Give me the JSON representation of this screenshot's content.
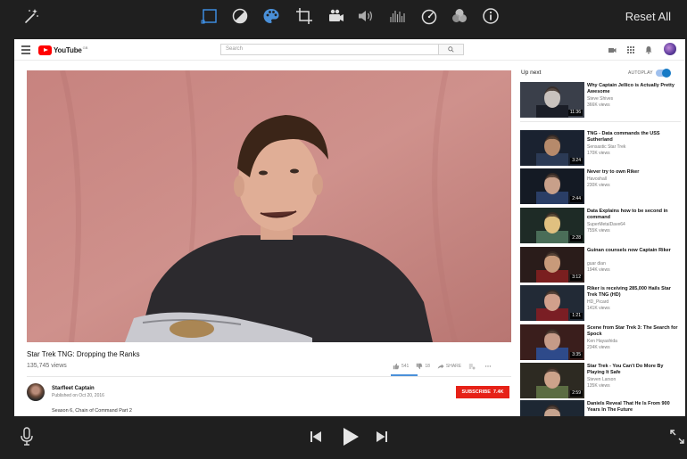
{
  "toolbar": {
    "reset_label": "Reset All",
    "icons": [
      "magic-wand-icon",
      "crop-frame-icon",
      "color-balance-icon",
      "color-palette-icon",
      "crop-icon",
      "video-camera-icon",
      "volume-icon",
      "equalizer-icon",
      "speedometer-icon",
      "filters-icon",
      "info-icon"
    ]
  },
  "youtube": {
    "logo_text": "YouTube",
    "region": "GB",
    "search_placeholder": "Search",
    "video_title": "Star Trek TNG: Dropping the Ranks",
    "views": "135,745 views",
    "likes": "541",
    "dislikes": "18",
    "share_label": "SHARE",
    "channel": "Starfleet Captain",
    "published": "Published on Oct 20, 2016",
    "subscribe_label": "SUBSCRIBE",
    "subscriber_count": "7.4K",
    "description": "Season 6, Chain of Command Part 2",
    "up_next_label": "Up next",
    "autoplay_label": "AUTOPLAY",
    "recommendations": [
      {
        "title": "Why Captain Jellico is Actually Pretty Awesome",
        "channel": "Steve Shives",
        "views": "366K views",
        "duration": "11:36"
      },
      {
        "title": "TNG - Data commands the USS Sutherland",
        "channel": "Sensastic Star Trek",
        "views": "170K views",
        "duration": "3:24"
      },
      {
        "title": "Never try to own Riker",
        "channel": "Havoshall",
        "views": "230K views",
        "duration": "2:44"
      },
      {
        "title": "Data Explains how to be second in command",
        "channel": "SuperMetalDave64",
        "views": "755K views",
        "duration": "2:28"
      },
      {
        "title": "Guinan counsels now Captain Riker",
        "channel": "guar dian",
        "views": "194K views",
        "duration": "3:12"
      },
      {
        "title": "Riker is receiving 285,000 Hails Star Trek TNG (HD)",
        "channel": "HD_Picard",
        "views": "141K views",
        "duration": "1:21"
      },
      {
        "title": "Scene from Star Trek 3: The Search for Spock",
        "channel": "Ken Hayashida",
        "views": "234K views",
        "duration": "3:35"
      },
      {
        "title": "Star Trek - You Can't Do More By Playing It Safe",
        "channel": "Steven Larson",
        "views": "135K views",
        "duration": "2:59"
      },
      {
        "title": "Daniels Reveal That He Is From 900 Years In The Future",
        "channel": "",
        "views": "",
        "duration": ""
      }
    ]
  },
  "colors": {
    "app_bg": "#1f1f1f",
    "accent_blue": "#4a90d9",
    "youtube_red": "#e62117"
  }
}
